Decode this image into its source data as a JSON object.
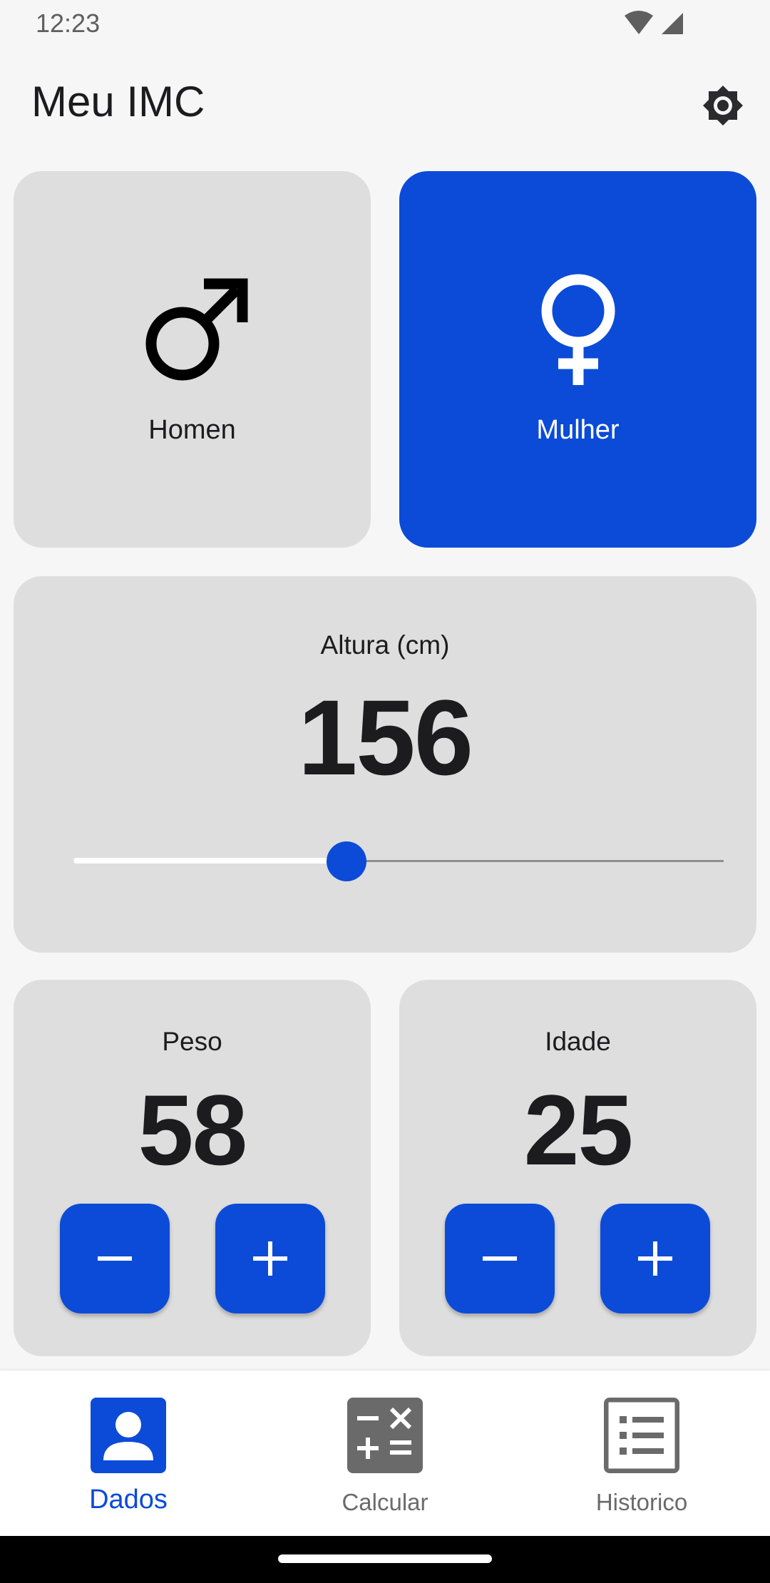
{
  "status_bar": {
    "time": "12:23"
  },
  "app_bar": {
    "title": "Meu IMC",
    "settings_icon": "brightness-settings-icon"
  },
  "gender": {
    "male": {
      "label": "Homen",
      "icon": "male-icon",
      "selected": false
    },
    "female": {
      "label": "Mulher",
      "icon": "female-icon",
      "selected": true
    }
  },
  "height": {
    "title": "Altura (cm)",
    "value": "156",
    "slider_fraction": 0.42
  },
  "weight": {
    "title": "Peso",
    "value": "58",
    "minus": "−",
    "plus": "+"
  },
  "age": {
    "title": "Idade",
    "value": "25",
    "minus": "−",
    "plus": "+"
  },
  "bottom_nav": {
    "items": [
      {
        "label": "Dados",
        "icon": "person-icon",
        "active": true
      },
      {
        "label": "Calcular",
        "icon": "calculator-icon",
        "active": false
      },
      {
        "label": "Historico",
        "icon": "list-icon",
        "active": false
      }
    ]
  },
  "colors": {
    "accent": "#0b4bd8",
    "card": "#dedede",
    "background": "#f6f6f6"
  }
}
